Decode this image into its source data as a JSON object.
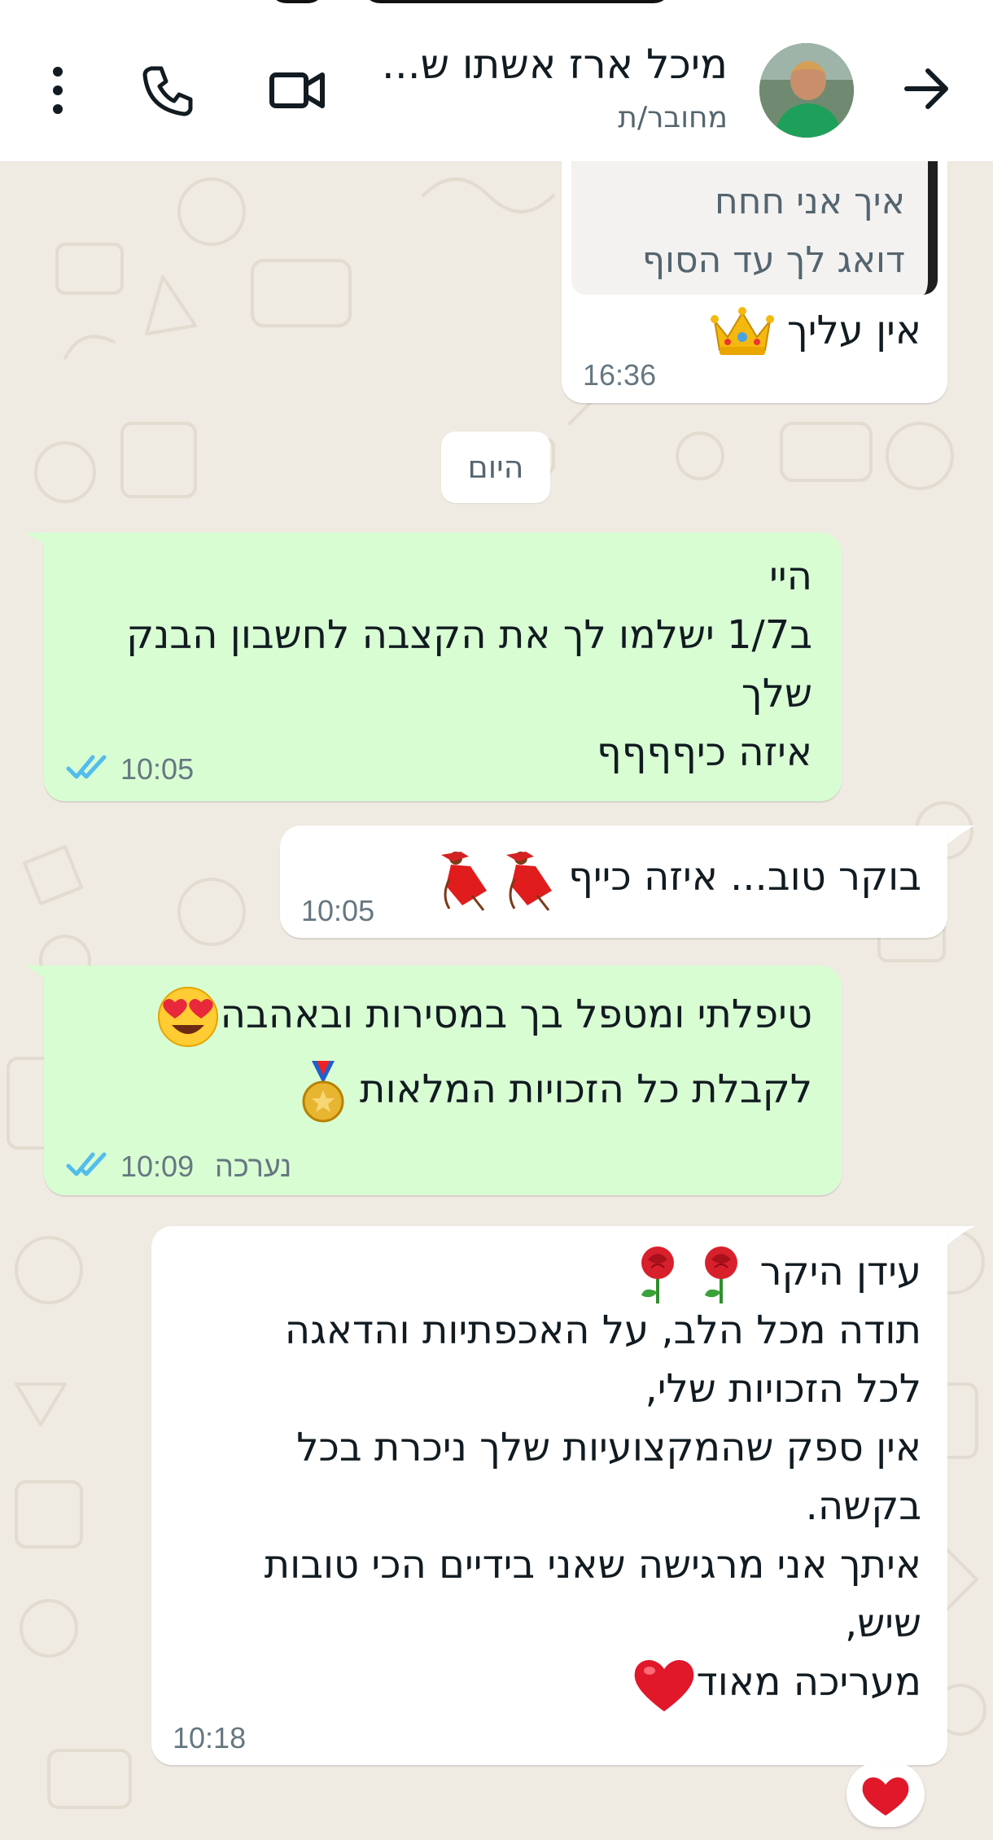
{
  "header": {
    "contact_name": "מיכל ארז אשתו ש...",
    "status": "מחובר/ת"
  },
  "icons": [
    "back-arrow-icon",
    "avatar",
    "video-call-icon",
    "phone-icon",
    "more-options-icon"
  ],
  "messages": [
    {
      "id": "m1",
      "direction": "incoming",
      "quoted_text": "איך אני חחח\nדואג לך עד הסוף",
      "text": "אין עליך",
      "emoji": [
        "crown"
      ],
      "time": "16:36"
    },
    {
      "id": "date",
      "date_label": "היום"
    },
    {
      "id": "m2",
      "direction": "outgoing",
      "text": "היי\nב1/7 ישלמו לך את הקצבה לחשבון הבנק\nשלך\nאיזה כיףףףף",
      "time": "10:05",
      "status": "read"
    },
    {
      "id": "m3",
      "direction": "incoming",
      "text": "בוקר טוב... איזה כייף",
      "emoji": [
        "dancer",
        "dancer"
      ],
      "time": "10:05"
    },
    {
      "id": "m4",
      "direction": "outgoing",
      "line1": "טיפלתי ומטפל בך במסירות ובאהבה",
      "line2": "לקבלת כל הזכויות המלאות",
      "emoji": [
        "heart-eyes",
        "medal"
      ],
      "edited_label": "נערכה",
      "time": "10:09",
      "status": "read"
    },
    {
      "id": "m5",
      "direction": "incoming",
      "line1": "עידן היקר",
      "body": "תודה מכל הלב, על האכפתיות והדאגה\nלכל הזכויות שלי,\nאין ספק שהמקצועיות שלך ניכרת בכל\nבקשה.\nאיתך אני מרגישה שאני בידיים הכי טובות\nשיש,",
      "last_line": "מעריכה מאוד",
      "emoji": [
        "rose",
        "rose",
        "red-heart"
      ],
      "time": "10:18",
      "reaction": "red-heart"
    }
  ],
  "colors": {
    "chat_background": "#efeae2",
    "incoming_bubble": "#ffffff",
    "outgoing_bubble": "#d9fdd3",
    "read_ticks": "#53bdeb",
    "timestamp": "#667781"
  }
}
